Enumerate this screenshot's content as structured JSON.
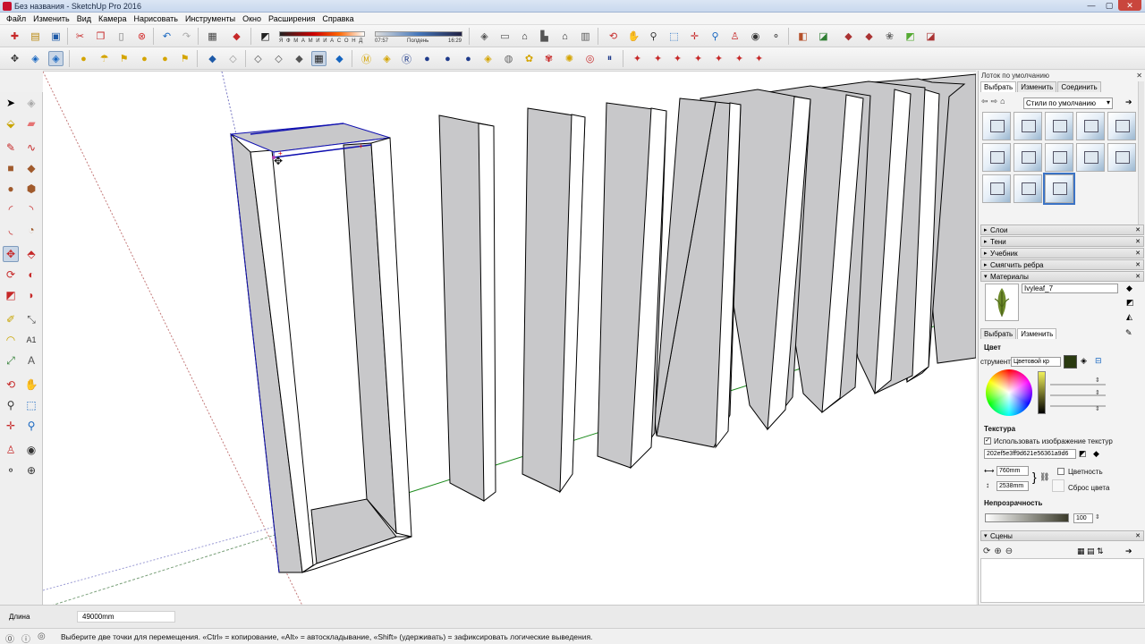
{
  "window": {
    "title": "Без названия - SketchUp Pro 2016",
    "minimize": "—",
    "maximize": "▢",
    "close": "✕"
  },
  "menu": [
    "Файл",
    "Изменить",
    "Вид",
    "Камера",
    "Нарисовать",
    "Инструменты",
    "Окно",
    "Расширения",
    "Справка"
  ],
  "shadow_bar": {
    "months": "Я Ф М А М И И А С О Н Д",
    "time_start": "07:57",
    "time_mid": "Полдень",
    "time_end": "16:29"
  },
  "tray": {
    "title": "Лоток по умолчанию",
    "close": "✕",
    "tabs": [
      "Выбрать",
      "Изменить",
      "Соединить"
    ],
    "styles_select": "Стили по умолчанию",
    "panels": [
      {
        "label": "Слои",
        "state": "collapsed"
      },
      {
        "label": "Тени",
        "state": "collapsed"
      },
      {
        "label": "Учебник",
        "state": "collapsed"
      },
      {
        "label": "Смягчить ребра",
        "state": "collapsed"
      },
      {
        "label": "Материалы",
        "state": "expanded"
      }
    ],
    "materials": {
      "name": "Ivyleaf_7",
      "tabs": [
        "Выбрать",
        "Изменить"
      ],
      "color_heading": "Цвет",
      "picker_label": "струмент",
      "picker_value": "Цветовой кр",
      "swatch_color": "#2a3a10",
      "texture_heading": "Текстура",
      "use_texture_label": "Использовать изображение текстур",
      "texture_file": "202ef5e3ff9d621e56361a9d6",
      "width": "760mm",
      "height": "2538mm",
      "colorize_label": "Цветность",
      "reset_color_label": "Сброс цвета",
      "opacity_heading": "Непрозрачность",
      "opacity_value": "100"
    },
    "scenes_label": "Сцены"
  },
  "measurements": {
    "label": "Длина",
    "value": "49000mm"
  },
  "status_text": "Выберите две точки для перемещения.  «Ctrl» = копирование, «Alt» = автоскладывание, «Shift» (удерживать) = зафиксировать логические выведения."
}
